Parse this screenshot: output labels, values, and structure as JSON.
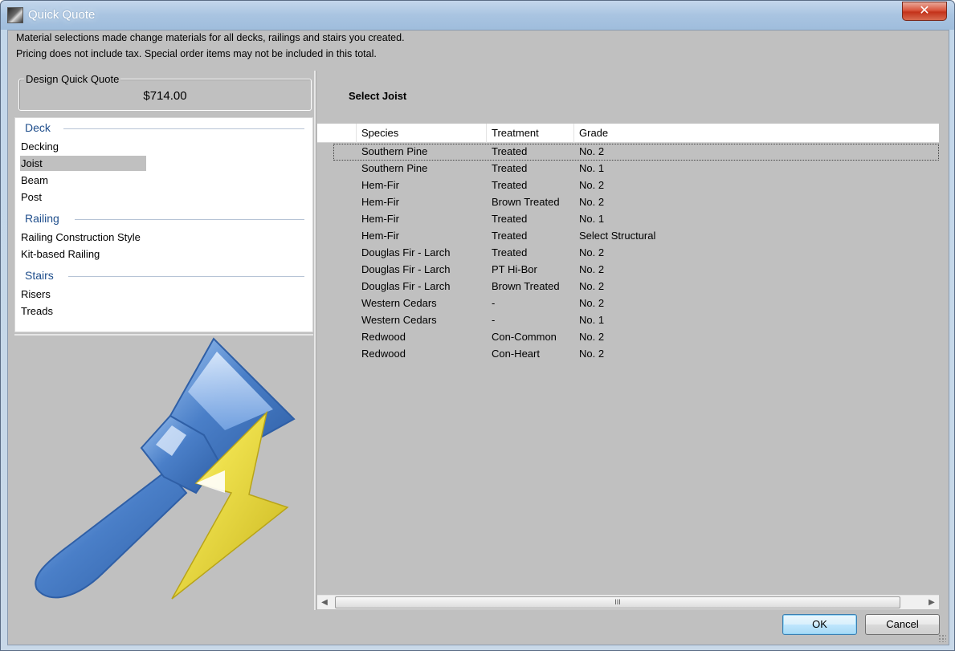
{
  "window": {
    "title": "Quick Quote",
    "close_label": "✕"
  },
  "info": {
    "line1": "Material selections made change materials for all decks, railings and stairs you created.",
    "line2": "Pricing does not include tax. Special order items may not be included in this total."
  },
  "quote": {
    "legend": "Design Quick Quote",
    "value": "$714.00"
  },
  "materials": {
    "deck": {
      "header": "Deck",
      "items": [
        "Decking",
        "Joist",
        "Beam",
        "Post"
      ]
    },
    "railing": {
      "header": "Railing",
      "items": [
        "Railing Construction Style",
        "Kit-based Railing"
      ]
    },
    "stairs": {
      "header": "Stairs",
      "items": [
        "Risers",
        "Treads"
      ]
    },
    "selected": "Joist"
  },
  "selection": {
    "title": "Select Joist"
  },
  "grid": {
    "columns": [
      "Species",
      "Treatment",
      "Grade"
    ],
    "rows": [
      [
        "Southern Pine",
        "Treated",
        "No. 2"
      ],
      [
        "Southern Pine",
        "Treated",
        "No. 1"
      ],
      [
        "Hem-Fir",
        "Treated",
        "No. 2"
      ],
      [
        "Hem-Fir",
        "Brown Treated",
        "No. 2"
      ],
      [
        "Hem-Fir",
        "Treated",
        "No. 1"
      ],
      [
        "Hem-Fir",
        "Treated",
        "Select Structural"
      ],
      [
        "Douglas Fir - Larch",
        "Treated",
        "No. 2"
      ],
      [
        "Douglas Fir - Larch",
        "PT Hi-Bor",
        "No. 2"
      ],
      [
        "Douglas Fir - Larch",
        "Brown Treated",
        "No. 2"
      ],
      [
        "Western Cedars",
        "-",
        "No. 2"
      ],
      [
        "Western Cedars",
        "-",
        "No. 1"
      ],
      [
        "Redwood",
        "Con-Common",
        "No. 2"
      ],
      [
        "Redwood",
        "Con-Heart",
        "No. 2"
      ]
    ],
    "current_row": 0
  },
  "scrollbar": {
    "left_arrow": "◀",
    "right_arrow": "▶",
    "thumb_grip": "III"
  },
  "buttons": {
    "ok": "OK",
    "cancel": "Cancel"
  },
  "icons": {
    "logo": "paintbrush-lightning-icon",
    "app": "app-icon"
  },
  "colors": {
    "accent_blue": "#4a7fc8",
    "bolt_yellow": "#e8d63a",
    "panel_gray": "#c0c0c0",
    "category_header": "#1f4e8c"
  }
}
